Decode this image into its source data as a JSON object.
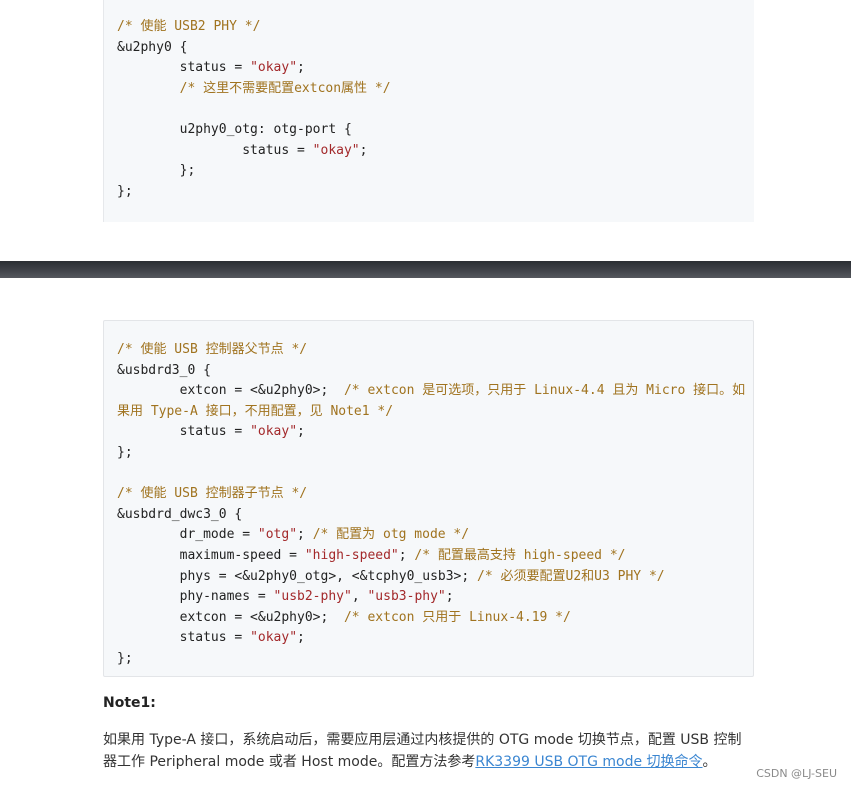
{
  "code_block_1": {
    "l01": "/* 使能 USB2 PHY */",
    "l02": "&u2phy0 {",
    "l03_key": "        status = ",
    "l03_str": "\"okay\"",
    "l03_end": ";",
    "l04": "        /* 这里不需要配置extcon属性 */",
    "l05": "",
    "l06": "        u2phy0_otg: otg-port {",
    "l07_key": "                status = ",
    "l07_str": "\"okay\"",
    "l07_end": ";",
    "l08": "        };",
    "l09": "};"
  },
  "code_block_2": {
    "l01": "/* 使能 USB 控制器父节点 */",
    "l02": "&usbdrd3_0 {",
    "l03_code": "        extcon = <&u2phy0>;  ",
    "l03_comment": "/* extcon 是可选项，只用于 Linux-4.4 且为 Micro 接口。如",
    "l04_comment": "果用 Type-A 接口，不用配置，见 Note1 */",
    "l05_key": "        status = ",
    "l05_str": "\"okay\"",
    "l05_end": ";",
    "l06": "};",
    "l07": "",
    "l08": "/* 使能 USB 控制器子节点 */",
    "l09": "&usbdrd_dwc3_0 {",
    "l10_key": "        dr_mode = ",
    "l10_str": "\"otg\"",
    "l10_end": "; ",
    "l10_comment": "/* 配置为 otg mode */",
    "l11_key": "        maximum-speed = ",
    "l11_str": "\"high-speed\"",
    "l11_end": "; ",
    "l11_comment": "/* 配置最高支持 high-speed */",
    "l12_code": "        phys = <&u2phy0_otg>, <&tcphy0_usb3>; ",
    "l12_comment": "/* 必须要配置U2和U3 PHY */",
    "l13_key": "        phy-names = ",
    "l13_str1": "\"usb2-phy\"",
    "l13_sep": ", ",
    "l13_str2": "\"usb3-phy\"",
    "l13_end": ";",
    "l14_code": "        extcon = <&u2phy0>;  ",
    "l14_comment": "/* extcon 只用于 Linux-4.19 */",
    "l15_key": "        status = ",
    "l15_str": "\"okay\"",
    "l15_end": ";",
    "l16": "};"
  },
  "note": {
    "title": "Note1:",
    "body": "如果用 Type-A 接口，系统启动后，需要应用层通过内核提供的 OTG mode 切换节点，配置 USB 控制器工作 Peripheral mode 或者 Host mode。配置方法参考",
    "link_text": "RK3399 USB OTG mode 切换命令",
    "tail": "。"
  },
  "watermark": "CSDN @LJ-SEU",
  "colors": {
    "code_background": "#f6f8fa",
    "comment": "#a0731f",
    "string": "#a3292b",
    "link": "#3b86d1",
    "divider": "#3c3f45"
  }
}
